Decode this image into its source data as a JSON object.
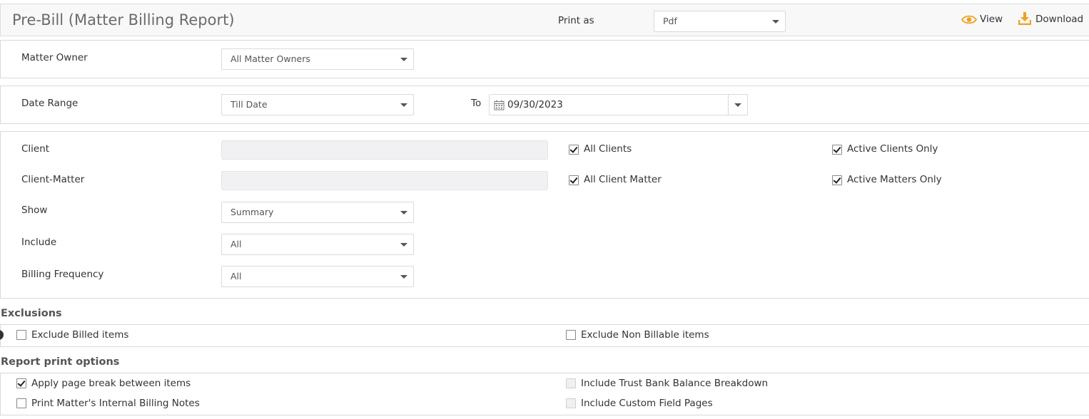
{
  "header": {
    "title": "Pre-Bill (Matter Billing Report)",
    "print_as_label": "Print as",
    "print_as_value": "Pdf",
    "view_label": "View",
    "download_label": "Download",
    "accent_color": "#f0a020"
  },
  "matter_owner": {
    "label": "Matter Owner",
    "value": "All Matter Owners"
  },
  "date_range": {
    "label": "Date Range",
    "value": "Till Date",
    "to_label": "To",
    "to_date": "09/30/2023"
  },
  "filters": {
    "client_label": "Client",
    "client_value": "",
    "client_matter_label": "Client-Matter",
    "client_matter_value": "",
    "all_clients_label": "All Clients",
    "all_clients_checked": true,
    "active_clients_label": "Active Clients Only",
    "active_clients_checked": true,
    "all_client_matter_label": "All Client Matter",
    "all_client_matter_checked": true,
    "active_matters_label": "Active Matters Only",
    "active_matters_checked": true,
    "show_label": "Show",
    "show_value": "Summary",
    "include_label": "Include",
    "include_value": "All",
    "billing_frequency_label": "Billing Frequency",
    "billing_frequency_value": "All"
  },
  "exclusions": {
    "title": "Exclusions",
    "exclude_billed_label": "Exclude Billed items",
    "exclude_billed_checked": false,
    "exclude_non_billable_label": "Exclude Non Billable items",
    "exclude_non_billable_checked": false
  },
  "print_options": {
    "title": "Report print options",
    "page_break_label": "Apply page break between items",
    "page_break_checked": true,
    "internal_notes_label": "Print Matter's Internal Billing Notes",
    "internal_notes_checked": false,
    "trust_balance_label": "Include Trust Bank Balance Breakdown",
    "trust_balance_checked": false,
    "custom_field_label": "Include Custom Field Pages",
    "custom_field_checked": false
  }
}
